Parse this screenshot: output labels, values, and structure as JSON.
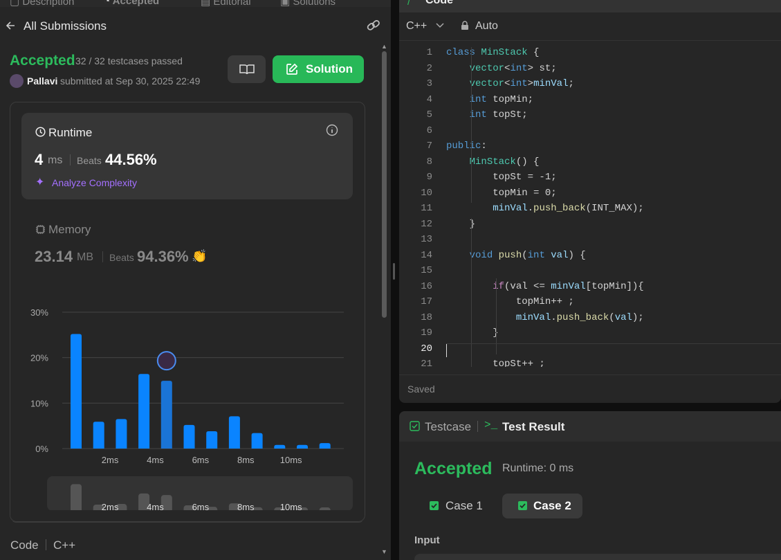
{
  "tabs": [
    "Description",
    "Accepted",
    "Editorial",
    "Solutions"
  ],
  "left": {
    "back_label": "All Submissions",
    "status": "Accepted",
    "testcases": "32 / 32 testcases passed",
    "user": "Pallavi",
    "submitted": "submitted at Sep 30, 2025 22:49",
    "solution_label": "Solution",
    "runtime": {
      "title": "Runtime",
      "value": "4",
      "unit": "ms",
      "beats_label": "Beats",
      "beats": "44.56%",
      "analyze": "Analyze Complexity"
    },
    "memory": {
      "title": "Memory",
      "value": "23.14",
      "unit": "MB",
      "beats_label": "Beats",
      "beats": "94.36%"
    },
    "footer": {
      "code_label": "Code",
      "lang": "C++"
    }
  },
  "chart_data": {
    "type": "bar",
    "ytick_labels": [
      "30%",
      "20%",
      "10%",
      "0%"
    ],
    "ylim": [
      0,
      30
    ],
    "xtick_labels": [
      "2ms",
      "4ms",
      "6ms",
      "8ms",
      "10ms"
    ],
    "values": [
      25.2,
      5.9,
      6.5,
      16.4,
      14.9,
      5.2,
      3.8,
      7.1,
      3.4,
      0.8,
      0.8,
      1.2
    ],
    "highlight_index": 4,
    "colors": {
      "bar": "#0a84ff",
      "highlight": "#1a74d6"
    }
  },
  "code_panel": {
    "title": "Code",
    "language": "C++",
    "mode": "Auto",
    "saved": "Saved",
    "lines": [
      "class MinStack {",
      "    vector<int> st;",
      "    vector<int>minVal;",
      "    int topMin;",
      "    int topSt;",
      "",
      "public:",
      "    MinStack() {",
      "        topSt = -1;",
      "        topMin = 0;",
      "        minVal.push_back(INT_MAX);",
      "    }",
      "",
      "    void push(int val) {",
      "",
      "        if(val <= minVal[topMin]){",
      "            topMin++ ;",
      "            minVal.push_back(val);",
      "        }",
      "",
      "        topSt++ ;"
    ]
  },
  "result_panel": {
    "tab_testcase": "Testcase",
    "tab_result": "Test Result",
    "status": "Accepted",
    "runtime": "Runtime: 0 ms",
    "cases": [
      "Case 1",
      "Case 2"
    ],
    "input_label": "Input"
  },
  "colors": {
    "accepted": "#2cbb5d",
    "solution_btn": "#28b858",
    "purple": "#a470ff"
  }
}
